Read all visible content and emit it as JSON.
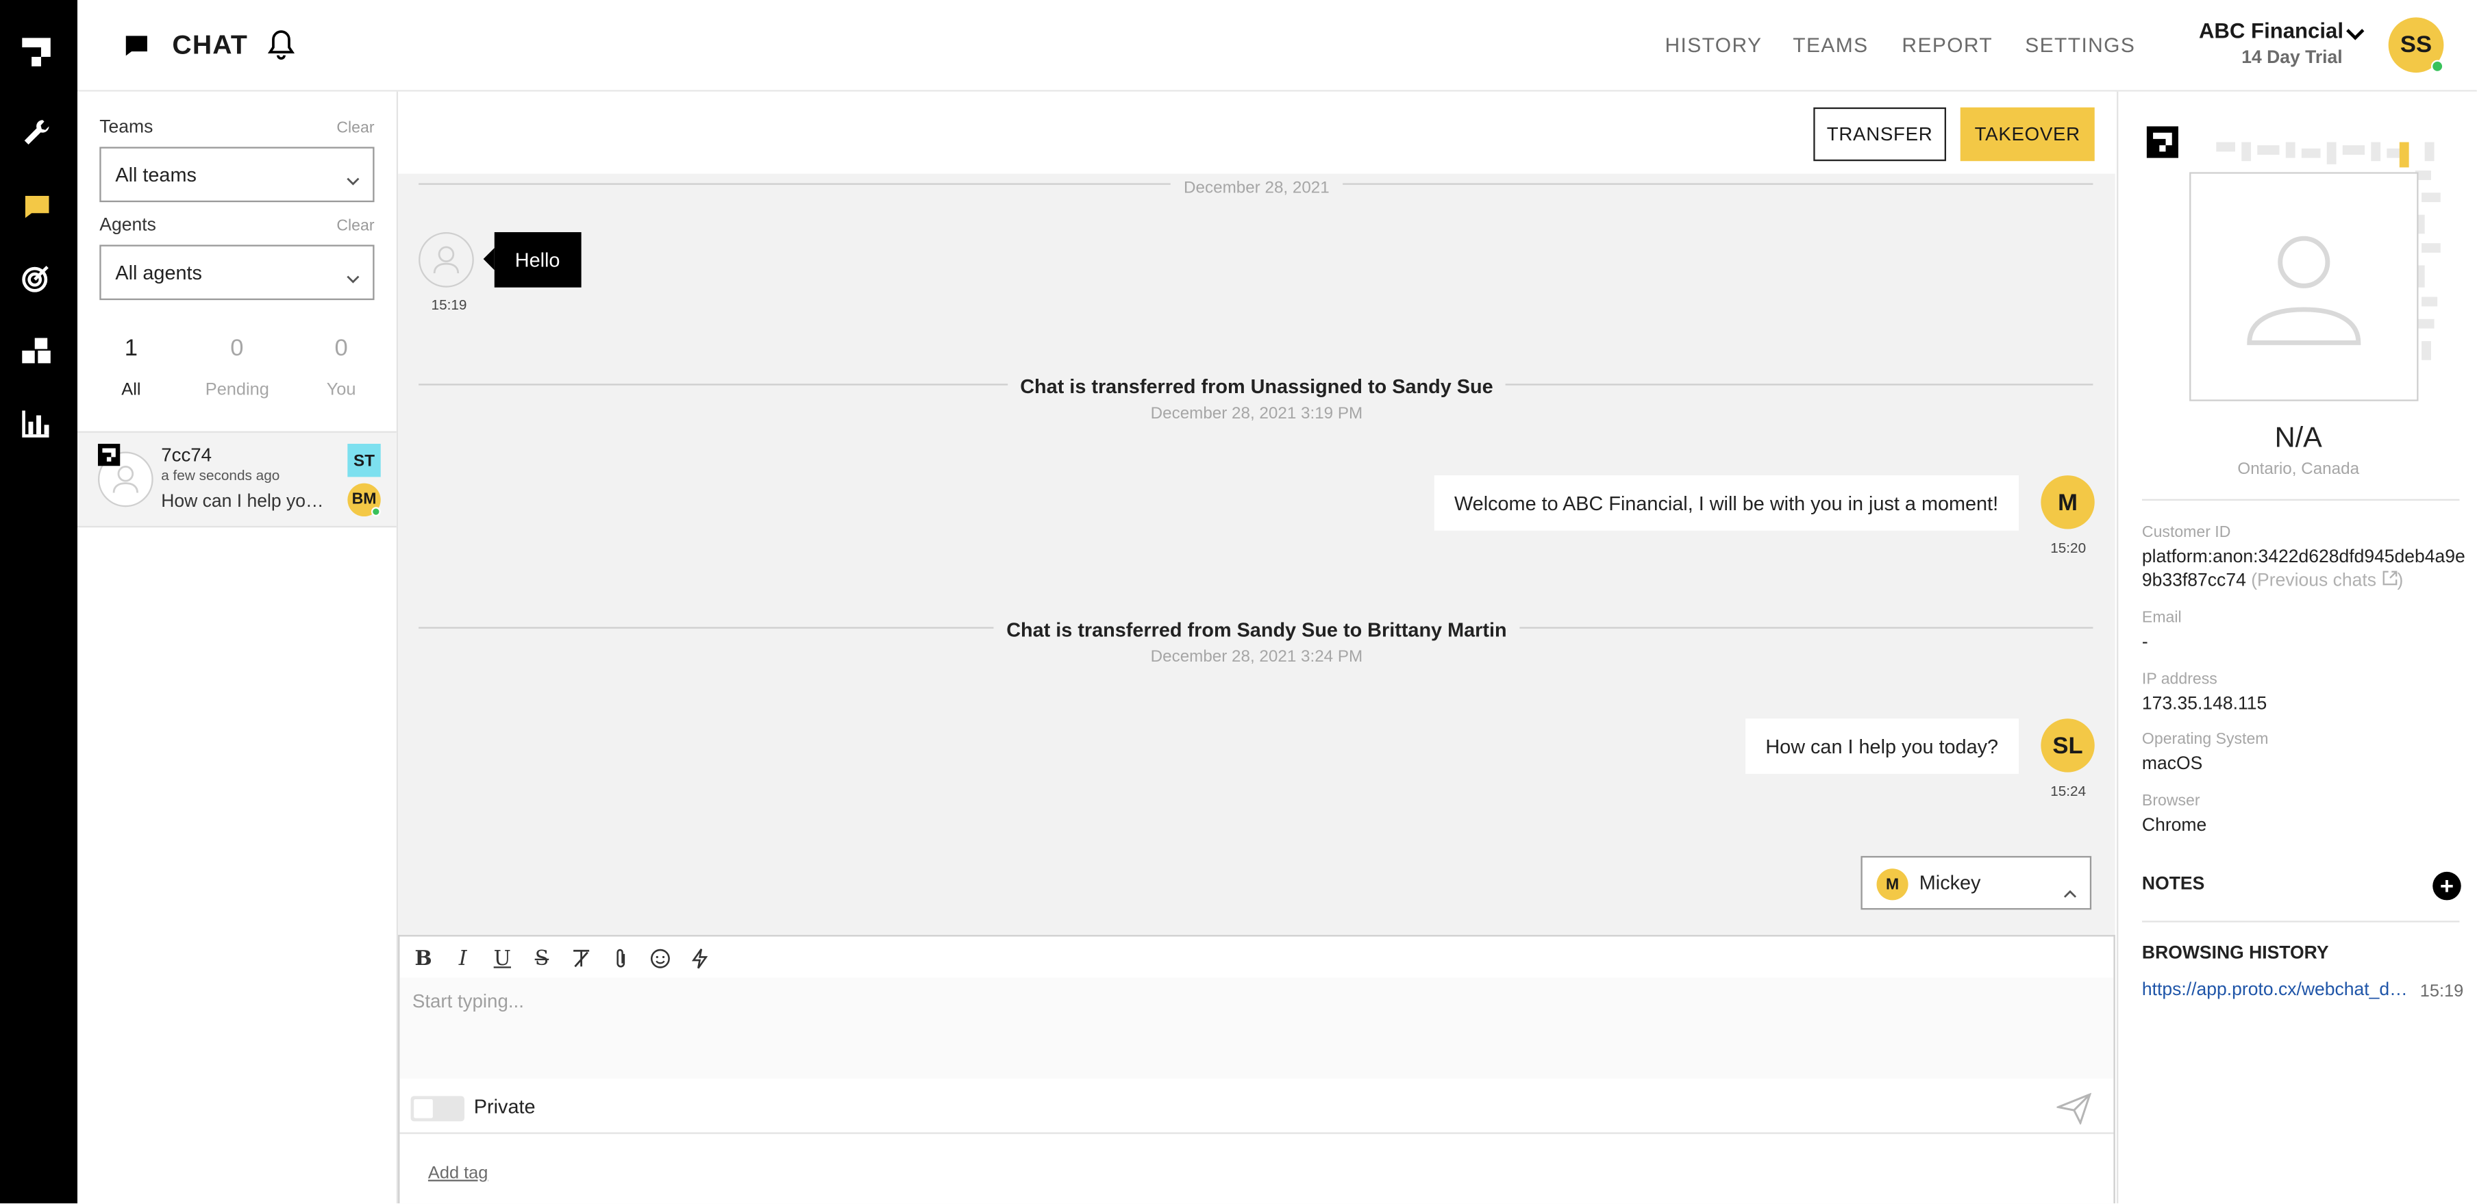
{
  "header": {
    "title": "CHAT",
    "nav": [
      "HISTORY",
      "TEAMS",
      "REPORT",
      "SETTINGS"
    ],
    "org_name": "ABC Financial",
    "trial": "14 Day Trial",
    "user_initials": "SS"
  },
  "sidebar_nav": {
    "icons": [
      "logo-icon",
      "wrench-icon",
      "chat-icon",
      "target-icon",
      "blocks-icon",
      "bar-chart-icon"
    ],
    "active": "chat-icon",
    "accent": "#f3c846"
  },
  "filters": {
    "teams_label": "Teams",
    "agents_label": "Agents",
    "clear": "Clear",
    "teams_value": "All teams",
    "agents_value": "All agents",
    "counts": [
      {
        "num": "1",
        "label": "All"
      },
      {
        "num": "0",
        "label": "Pending"
      },
      {
        "num": "0",
        "label": "You"
      }
    ]
  },
  "conversation": {
    "id": "7cc74",
    "time": "a few seconds ago",
    "preview": "How can I help you today?",
    "badge_team": "ST",
    "badge_agent": "BM"
  },
  "actions": {
    "transfer": "TRANSFER",
    "takeover": "TAKEOVER"
  },
  "messages": {
    "date_top": "December 28, 2021",
    "customer_msg": "Hello",
    "customer_time": "15:19",
    "transfer1_text": "Chat is transferred from Unassigned to Sandy Sue",
    "transfer1_date": "December 28, 2021 3:19 PM",
    "agent1_msg": "Welcome to ABC Financial, I will be with you in just a moment!",
    "agent1_initials": "M",
    "agent1_time": "15:20",
    "transfer2_text": "Chat is transferred from Sandy Sue to Brittany Martin",
    "transfer2_date": "December 28, 2021 3:24 PM",
    "agent2_msg": "How can I help you today?",
    "agent2_initials": "SL",
    "agent2_time": "15:24"
  },
  "agent_picker": {
    "initial": "M",
    "name": "Mickey"
  },
  "composer": {
    "toolbar": [
      "bold-icon",
      "italic-icon",
      "underline-icon",
      "strikethrough-icon",
      "clear-format-icon",
      "attach-icon",
      "emoji-icon",
      "lightning-icon"
    ],
    "placeholder": "Start typing...",
    "private_label": "Private",
    "add_tag": "Add tag"
  },
  "customer": {
    "name": "N/A",
    "location": "Ontario, Canada",
    "id_label": "Customer ID",
    "id_value": "platform:anon:3422d628dfd945deb4a9e9b33f87cc74",
    "previous_chats": "(Previous chats",
    "email_label": "Email",
    "email_value": "-",
    "ip_label": "IP address",
    "ip_value": "173.35.148.115",
    "os_label": "Operating System",
    "os_value": "macOS",
    "browser_label": "Browser",
    "browser_value": "Chrome",
    "notes_label": "NOTES",
    "history_label": "BROWSING HISTORY",
    "history_url": "https://app.proto.cx/webchat_demo",
    "history_time": "15:19"
  }
}
